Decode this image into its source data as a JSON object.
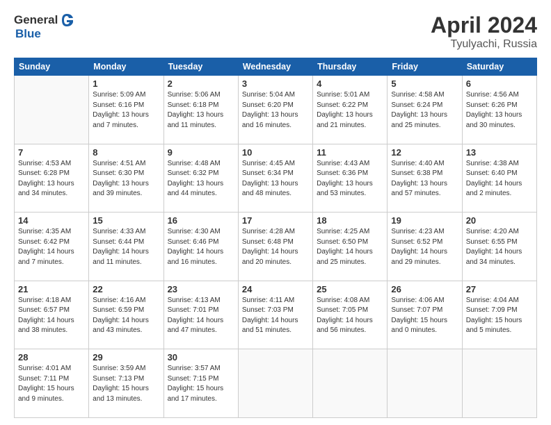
{
  "header": {
    "logo_general": "General",
    "logo_blue": "Blue",
    "title": "April 2024",
    "subtitle": "Tyulyachi, Russia"
  },
  "columns": [
    "Sunday",
    "Monday",
    "Tuesday",
    "Wednesday",
    "Thursday",
    "Friday",
    "Saturday"
  ],
  "weeks": [
    [
      {
        "day": "",
        "sunrise": "",
        "sunset": "",
        "daylight": "",
        "empty": true
      },
      {
        "day": "1",
        "sunrise": "Sunrise: 5:09 AM",
        "sunset": "Sunset: 6:16 PM",
        "daylight": "Daylight: 13 hours and 7 minutes.",
        "empty": false
      },
      {
        "day": "2",
        "sunrise": "Sunrise: 5:06 AM",
        "sunset": "Sunset: 6:18 PM",
        "daylight": "Daylight: 13 hours and 11 minutes.",
        "empty": false
      },
      {
        "day": "3",
        "sunrise": "Sunrise: 5:04 AM",
        "sunset": "Sunset: 6:20 PM",
        "daylight": "Daylight: 13 hours and 16 minutes.",
        "empty": false
      },
      {
        "day": "4",
        "sunrise": "Sunrise: 5:01 AM",
        "sunset": "Sunset: 6:22 PM",
        "daylight": "Daylight: 13 hours and 21 minutes.",
        "empty": false
      },
      {
        "day": "5",
        "sunrise": "Sunrise: 4:58 AM",
        "sunset": "Sunset: 6:24 PM",
        "daylight": "Daylight: 13 hours and 25 minutes.",
        "empty": false
      },
      {
        "day": "6",
        "sunrise": "Sunrise: 4:56 AM",
        "sunset": "Sunset: 6:26 PM",
        "daylight": "Daylight: 13 hours and 30 minutes.",
        "empty": false
      }
    ],
    [
      {
        "day": "7",
        "sunrise": "Sunrise: 4:53 AM",
        "sunset": "Sunset: 6:28 PM",
        "daylight": "Daylight: 13 hours and 34 minutes.",
        "empty": false
      },
      {
        "day": "8",
        "sunrise": "Sunrise: 4:51 AM",
        "sunset": "Sunset: 6:30 PM",
        "daylight": "Daylight: 13 hours and 39 minutes.",
        "empty": false
      },
      {
        "day": "9",
        "sunrise": "Sunrise: 4:48 AM",
        "sunset": "Sunset: 6:32 PM",
        "daylight": "Daylight: 13 hours and 44 minutes.",
        "empty": false
      },
      {
        "day": "10",
        "sunrise": "Sunrise: 4:45 AM",
        "sunset": "Sunset: 6:34 PM",
        "daylight": "Daylight: 13 hours and 48 minutes.",
        "empty": false
      },
      {
        "day": "11",
        "sunrise": "Sunrise: 4:43 AM",
        "sunset": "Sunset: 6:36 PM",
        "daylight": "Daylight: 13 hours and 53 minutes.",
        "empty": false
      },
      {
        "day": "12",
        "sunrise": "Sunrise: 4:40 AM",
        "sunset": "Sunset: 6:38 PM",
        "daylight": "Daylight: 13 hours and 57 minutes.",
        "empty": false
      },
      {
        "day": "13",
        "sunrise": "Sunrise: 4:38 AM",
        "sunset": "Sunset: 6:40 PM",
        "daylight": "Daylight: 14 hours and 2 minutes.",
        "empty": false
      }
    ],
    [
      {
        "day": "14",
        "sunrise": "Sunrise: 4:35 AM",
        "sunset": "Sunset: 6:42 PM",
        "daylight": "Daylight: 14 hours and 7 minutes.",
        "empty": false
      },
      {
        "day": "15",
        "sunrise": "Sunrise: 4:33 AM",
        "sunset": "Sunset: 6:44 PM",
        "daylight": "Daylight: 14 hours and 11 minutes.",
        "empty": false
      },
      {
        "day": "16",
        "sunrise": "Sunrise: 4:30 AM",
        "sunset": "Sunset: 6:46 PM",
        "daylight": "Daylight: 14 hours and 16 minutes.",
        "empty": false
      },
      {
        "day": "17",
        "sunrise": "Sunrise: 4:28 AM",
        "sunset": "Sunset: 6:48 PM",
        "daylight": "Daylight: 14 hours and 20 minutes.",
        "empty": false
      },
      {
        "day": "18",
        "sunrise": "Sunrise: 4:25 AM",
        "sunset": "Sunset: 6:50 PM",
        "daylight": "Daylight: 14 hours and 25 minutes.",
        "empty": false
      },
      {
        "day": "19",
        "sunrise": "Sunrise: 4:23 AM",
        "sunset": "Sunset: 6:52 PM",
        "daylight": "Daylight: 14 hours and 29 minutes.",
        "empty": false
      },
      {
        "day": "20",
        "sunrise": "Sunrise: 4:20 AM",
        "sunset": "Sunset: 6:55 PM",
        "daylight": "Daylight: 14 hours and 34 minutes.",
        "empty": false
      }
    ],
    [
      {
        "day": "21",
        "sunrise": "Sunrise: 4:18 AM",
        "sunset": "Sunset: 6:57 PM",
        "daylight": "Daylight: 14 hours and 38 minutes.",
        "empty": false
      },
      {
        "day": "22",
        "sunrise": "Sunrise: 4:16 AM",
        "sunset": "Sunset: 6:59 PM",
        "daylight": "Daylight: 14 hours and 43 minutes.",
        "empty": false
      },
      {
        "day": "23",
        "sunrise": "Sunrise: 4:13 AM",
        "sunset": "Sunset: 7:01 PM",
        "daylight": "Daylight: 14 hours and 47 minutes.",
        "empty": false
      },
      {
        "day": "24",
        "sunrise": "Sunrise: 4:11 AM",
        "sunset": "Sunset: 7:03 PM",
        "daylight": "Daylight: 14 hours and 51 minutes.",
        "empty": false
      },
      {
        "day": "25",
        "sunrise": "Sunrise: 4:08 AM",
        "sunset": "Sunset: 7:05 PM",
        "daylight": "Daylight: 14 hours and 56 minutes.",
        "empty": false
      },
      {
        "day": "26",
        "sunrise": "Sunrise: 4:06 AM",
        "sunset": "Sunset: 7:07 PM",
        "daylight": "Daylight: 15 hours and 0 minutes.",
        "empty": false
      },
      {
        "day": "27",
        "sunrise": "Sunrise: 4:04 AM",
        "sunset": "Sunset: 7:09 PM",
        "daylight": "Daylight: 15 hours and 5 minutes.",
        "empty": false
      }
    ],
    [
      {
        "day": "28",
        "sunrise": "Sunrise: 4:01 AM",
        "sunset": "Sunset: 7:11 PM",
        "daylight": "Daylight: 15 hours and 9 minutes.",
        "empty": false
      },
      {
        "day": "29",
        "sunrise": "Sunrise: 3:59 AM",
        "sunset": "Sunset: 7:13 PM",
        "daylight": "Daylight: 15 hours and 13 minutes.",
        "empty": false
      },
      {
        "day": "30",
        "sunrise": "Sunrise: 3:57 AM",
        "sunset": "Sunset: 7:15 PM",
        "daylight": "Daylight: 15 hours and 17 minutes.",
        "empty": false
      },
      {
        "day": "",
        "sunrise": "",
        "sunset": "",
        "daylight": "",
        "empty": true
      },
      {
        "day": "",
        "sunrise": "",
        "sunset": "",
        "daylight": "",
        "empty": true
      },
      {
        "day": "",
        "sunrise": "",
        "sunset": "",
        "daylight": "",
        "empty": true
      },
      {
        "day": "",
        "sunrise": "",
        "sunset": "",
        "daylight": "",
        "empty": true
      }
    ]
  ]
}
